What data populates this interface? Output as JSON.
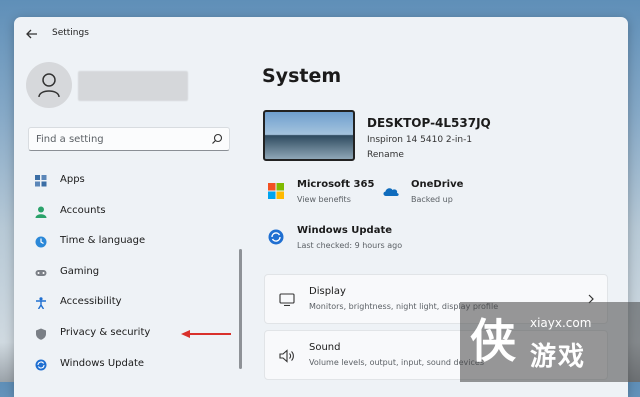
{
  "window": {
    "title": "Settings"
  },
  "search": {
    "placeholder": "Find a setting"
  },
  "sidebar": {
    "items": [
      {
        "label": "Apps",
        "icon": "apps-icon",
        "color": "#3b6ea5"
      },
      {
        "label": "Accounts",
        "icon": "person-icon",
        "color": "#2aa26a"
      },
      {
        "label": "Time & language",
        "icon": "globe-clock-icon",
        "color": "#2b88d8"
      },
      {
        "label": "Gaming",
        "icon": "controller-icon",
        "color": "#7a7f86"
      },
      {
        "label": "Accessibility",
        "icon": "accessibility-icon",
        "color": "#1f6fd1"
      },
      {
        "label": "Privacy & security",
        "icon": "shield-icon",
        "color": "#7a7f86"
      },
      {
        "label": "Windows Update",
        "icon": "update-icon",
        "color": "#1f6fd1"
      }
    ]
  },
  "main": {
    "title": "System",
    "device": {
      "name": "DESKTOP-4L537JQ",
      "model": "Inspiron 14 5410 2-in-1",
      "rename": "Rename"
    },
    "tiles": [
      {
        "title": "Microsoft 365",
        "sub": "View benefits",
        "icon": "microsoft-logo-icon"
      },
      {
        "title": "OneDrive",
        "sub": "Backed up",
        "icon": "cloud-icon"
      },
      {
        "title": "Windows Update",
        "sub": "Last checked: 9 hours ago",
        "icon": "update-icon"
      }
    ],
    "cards": [
      {
        "title": "Display",
        "sub": "Monitors, brightness, night light, display profile",
        "icon": "monitor-icon"
      },
      {
        "title": "Sound",
        "sub": "Volume levels, output, input, sound devices",
        "icon": "speaker-icon"
      }
    ]
  },
  "watermark": {
    "url": "xiayx.com",
    "symbol": "侠",
    "text": "游戏"
  },
  "colors": {
    "accent": "#0067c0",
    "annotation_arrow": "#d9312b"
  }
}
